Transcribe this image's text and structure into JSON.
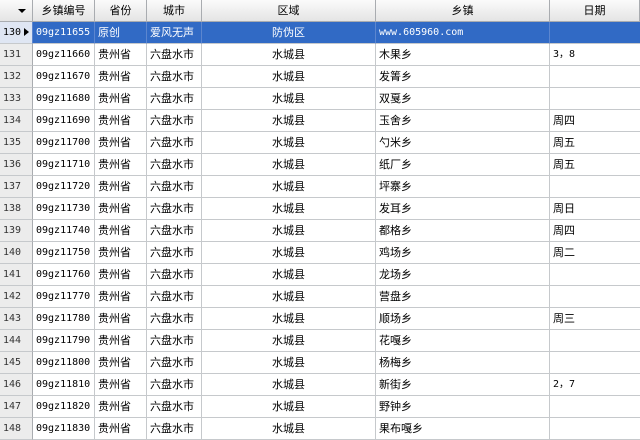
{
  "columns": [
    "乡镇编号",
    "省份",
    "城市",
    "区域",
    "乡镇",
    "日期"
  ],
  "rows": [
    {
      "n": "130",
      "code": "09gz11655",
      "prov": "原创",
      "city": "爱风无声",
      "area": "防伪区",
      "town": "www.605960.com",
      "date": ""
    },
    {
      "n": "131",
      "code": "09gz11660",
      "prov": "贵州省",
      "city": "六盘水市",
      "area": "水城县",
      "town": "木果乡",
      "date": "3，8"
    },
    {
      "n": "132",
      "code": "09gz11670",
      "prov": "贵州省",
      "city": "六盘水市",
      "area": "水城县",
      "town": "发箐乡",
      "date": ""
    },
    {
      "n": "133",
      "code": "09gz11680",
      "prov": "贵州省",
      "city": "六盘水市",
      "area": "水城县",
      "town": "双戛乡",
      "date": ""
    },
    {
      "n": "134",
      "code": "09gz11690",
      "prov": "贵州省",
      "city": "六盘水市",
      "area": "水城县",
      "town": "玉舍乡",
      "date": "周四"
    },
    {
      "n": "135",
      "code": "09gz11700",
      "prov": "贵州省",
      "city": "六盘水市",
      "area": "水城县",
      "town": "勺米乡",
      "date": "周五"
    },
    {
      "n": "136",
      "code": "09gz11710",
      "prov": "贵州省",
      "city": "六盘水市",
      "area": "水城县",
      "town": "纸厂乡",
      "date": "周五"
    },
    {
      "n": "137",
      "code": "09gz11720",
      "prov": "贵州省",
      "city": "六盘水市",
      "area": "水城县",
      "town": "坪寨乡",
      "date": ""
    },
    {
      "n": "138",
      "code": "09gz11730",
      "prov": "贵州省",
      "city": "六盘水市",
      "area": "水城县",
      "town": "发耳乡",
      "date": "周日"
    },
    {
      "n": "139",
      "code": "09gz11740",
      "prov": "贵州省",
      "city": "六盘水市",
      "area": "水城县",
      "town": "都格乡",
      "date": "周四"
    },
    {
      "n": "140",
      "code": "09gz11750",
      "prov": "贵州省",
      "city": "六盘水市",
      "area": "水城县",
      "town": "鸡场乡",
      "date": "周二"
    },
    {
      "n": "141",
      "code": "09gz11760",
      "prov": "贵州省",
      "city": "六盘水市",
      "area": "水城县",
      "town": "龙场乡",
      "date": ""
    },
    {
      "n": "142",
      "code": "09gz11770",
      "prov": "贵州省",
      "city": "六盘水市",
      "area": "水城县",
      "town": "营盘乡",
      "date": ""
    },
    {
      "n": "143",
      "code": "09gz11780",
      "prov": "贵州省",
      "city": "六盘水市",
      "area": "水城县",
      "town": "顺场乡",
      "date": "周三"
    },
    {
      "n": "144",
      "code": "09gz11790",
      "prov": "贵州省",
      "city": "六盘水市",
      "area": "水城县",
      "town": "花嘎乡",
      "date": ""
    },
    {
      "n": "145",
      "code": "09gz11800",
      "prov": "贵州省",
      "city": "六盘水市",
      "area": "水城县",
      "town": "杨梅乡",
      "date": ""
    },
    {
      "n": "146",
      "code": "09gz11810",
      "prov": "贵州省",
      "city": "六盘水市",
      "area": "水城县",
      "town": "新街乡",
      "date": "2，7"
    },
    {
      "n": "147",
      "code": "09gz11820",
      "prov": "贵州省",
      "city": "六盘水市",
      "area": "水城县",
      "town": "野钟乡",
      "date": ""
    },
    {
      "n": "148",
      "code": "09gz11830",
      "prov": "贵州省",
      "city": "六盘水市",
      "area": "水城县",
      "town": "果布嘎乡",
      "date": ""
    }
  ],
  "selected_row": "130",
  "colors": {
    "selection": "#316ac5",
    "header": "#e4e4e4",
    "grid": "#c6c9cc"
  }
}
